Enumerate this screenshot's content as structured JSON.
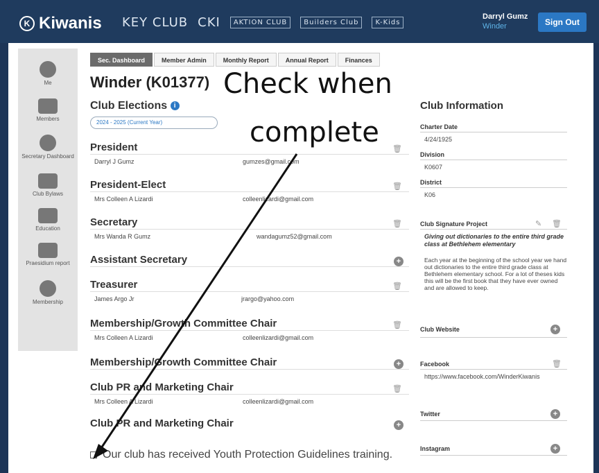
{
  "header": {
    "logo_text": "Kiwanis",
    "brands": [
      "KEY CLUB",
      "CKI",
      "AKTION CLUB",
      "Builders Club",
      "K-Kids"
    ],
    "user_name": "Darryl Gumz",
    "user_club": "Winder",
    "sign_out_label": "Sign Out"
  },
  "sidebar": {
    "items": [
      {
        "label": "Me",
        "icon": "user-icon"
      },
      {
        "label": "Members",
        "icon": "members-icon"
      },
      {
        "label": "Secretary Dashboard",
        "icon": "dollar-icon"
      },
      {
        "label": "Club Bylaws",
        "icon": "gavel-icon"
      },
      {
        "label": "Education",
        "icon": "education-icon"
      },
      {
        "label": "Praesidium report",
        "icon": "report-icon"
      },
      {
        "label": "Membership",
        "icon": "kiwanis-icon"
      }
    ]
  },
  "tabs": [
    "Sec. Dashboard",
    "Member Admin",
    "Monthly Report",
    "Annual Report",
    "Finances"
  ],
  "club_title": "Winder (K01377)",
  "overlay": {
    "line1": "Check when",
    "line2": "complete"
  },
  "elections": {
    "heading": "Club Elections",
    "year_option": "2024 - 2025 (Current Year)",
    "roles": [
      {
        "title": "President",
        "member": "Darryl J Gumz",
        "email": "gumzes@gmail.com",
        "action": "trash"
      },
      {
        "title": "President-Elect",
        "member": "Mrs Colleen A Lizardi",
        "email": "colleenlizardi@gmail.com",
        "action": "trash"
      },
      {
        "title": "Secretary",
        "member": "Mrs Wanda R Gumz",
        "email": "wandagumz52@gmail.com",
        "action": "trash"
      },
      {
        "title": "Assistant Secretary",
        "member": "",
        "email": "",
        "action": "add"
      },
      {
        "title": "Treasurer",
        "member": "James Argo Jr",
        "email": "jrargo@yahoo.com",
        "action": "trash"
      },
      {
        "title": "Membership/Growth Committee Chair",
        "member": "Mrs Colleen A Lizardi",
        "email": "colleenlizardi@gmail.com",
        "action": "trash"
      },
      {
        "title": "Membership/Growth Committee Chair",
        "member": "",
        "email": "",
        "action": "add"
      },
      {
        "title": "Club PR and Marketing Chair",
        "member": "Mrs Colleen A Lizardi",
        "email": "colleenlizardi@gmail.com",
        "action": "trash"
      },
      {
        "title": "Club PR and Marketing Chair",
        "member": "",
        "email": "",
        "action": "add"
      }
    ]
  },
  "club_info": {
    "heading": "Club Information",
    "charter_label": "Charter Date",
    "charter_value": "4/24/1925",
    "division_label": "Division",
    "division_value": "K0607",
    "district_label": "District",
    "district_value": "K06",
    "project_label": "Club Signature Project",
    "project_title": "Giving out dictionaries to the entire third grade class at Bethlehem elementary",
    "project_body": "Each year at the beginning of the school year we hand out dictionaries to the entire third grade class at Bethlehem elementary school. For a lot of theses kids this will be the first book that they have ever owned and are allowed to keep.",
    "website_label": "Club Website",
    "facebook_label": "Facebook",
    "facebook_value": "https://www.facebook.com/WinderKiwanis",
    "twitter_label": "Twitter",
    "instagram_label": "Instagram"
  },
  "ypg_text": "Our club has received Youth Protection Guidelines training."
}
